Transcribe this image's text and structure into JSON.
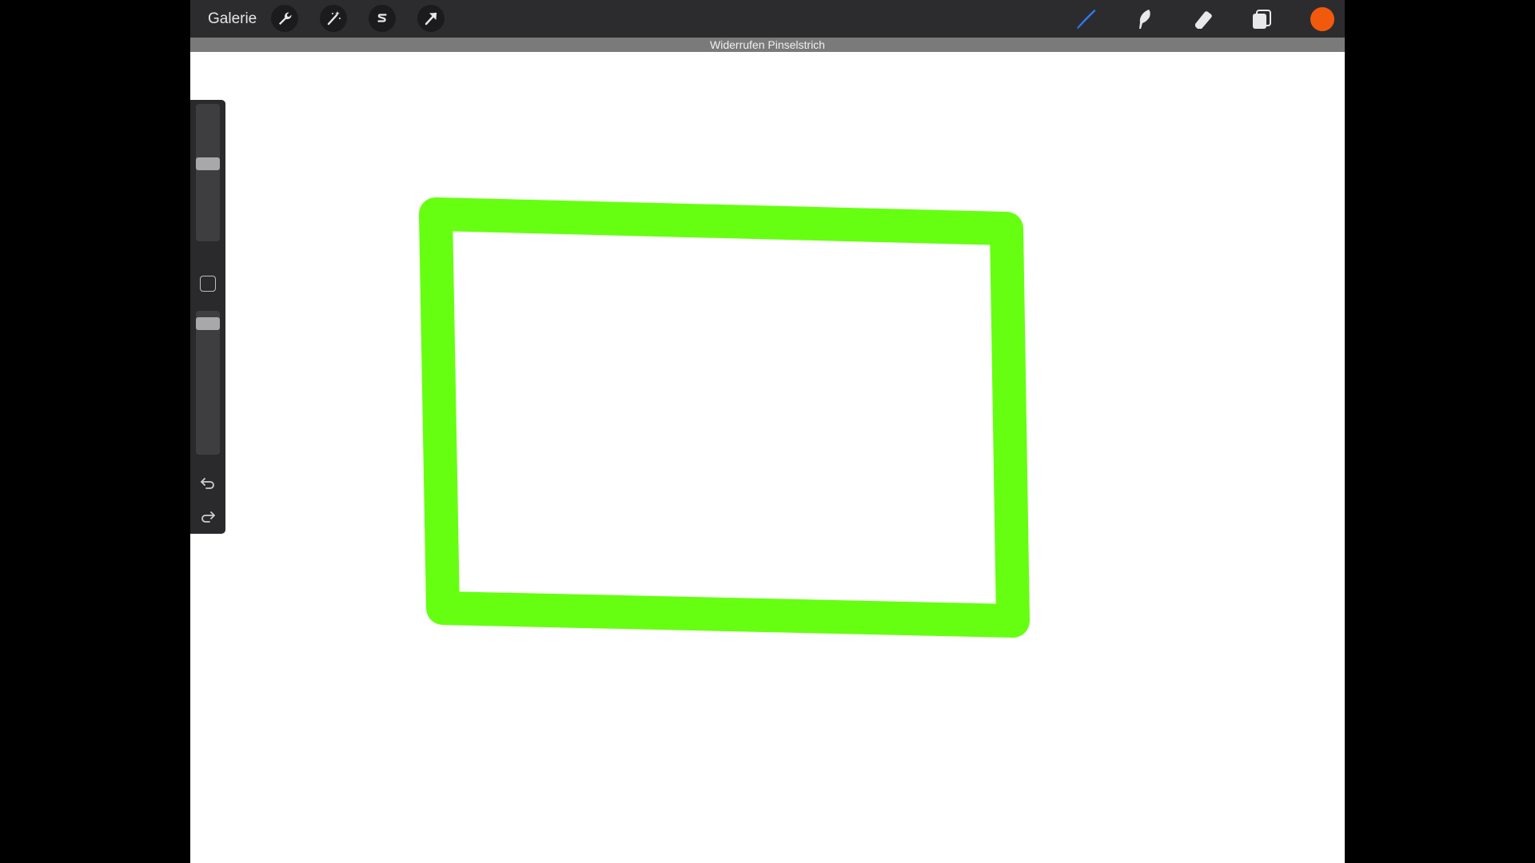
{
  "topbar": {
    "gallery_label": "Galerie",
    "left_tools": [
      {
        "name": "actions-wrench-icon"
      },
      {
        "name": "adjustments-magic-wand-icon"
      },
      {
        "name": "selection-s-icon"
      },
      {
        "name": "transform-arrow-icon"
      }
    ],
    "right_tools": [
      {
        "name": "brush-icon",
        "active": true
      },
      {
        "name": "smudge-icon",
        "active": false
      },
      {
        "name": "eraser-icon",
        "active": false
      },
      {
        "name": "layers-icon",
        "active": false
      }
    ],
    "current_color": "#f15a0c"
  },
  "notice": {
    "text": "Widerrufen Pinselstrich"
  },
  "sidebar": {
    "brush_size_level": 0.57,
    "opacity_level": 0.95,
    "undo_icon": "undo-arrow-icon",
    "redo_icon": "redo-arrow-icon"
  },
  "canvas": {
    "background": "#ffffff",
    "stroke_color": "#66ff11",
    "shape": "hand-drawn rectangle outline"
  },
  "colors": {
    "topbar_bg": "#2c2c2e",
    "accent_blue": "#2f7cf6",
    "notice_bg": "#7a7a7a"
  }
}
